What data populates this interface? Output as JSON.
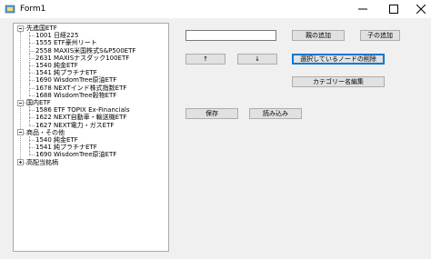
{
  "window": {
    "title": "Form1"
  },
  "tree": {
    "nodes": [
      {
        "label": "先進国ETF",
        "level": 0,
        "expander": "expanded"
      },
      {
        "label": "1001 日経225",
        "level": 1
      },
      {
        "label": "1555 ETF豪州リート",
        "level": 1
      },
      {
        "label": "2558 MAXIS米国株式S&P500ETF",
        "level": 1
      },
      {
        "label": "2631 MAXISナスダック100ETF",
        "level": 1
      },
      {
        "label": "1540 純金ETF",
        "level": 1
      },
      {
        "label": "1541 純プラチナETF",
        "level": 1
      },
      {
        "label": "1690 WisdomTree原油ETF",
        "level": 1
      },
      {
        "label": "1678 NEXTインド株式指数ETF",
        "level": 1
      },
      {
        "label": "1688 WisdomTree穀物ETF",
        "level": 1
      },
      {
        "label": "国内ETF",
        "level": 0,
        "expander": "expanded"
      },
      {
        "label": "1586 ETF TOPIX Ex-Financials",
        "level": 1
      },
      {
        "label": "1622 NEXT自動車・輸送機ETF",
        "level": 1
      },
      {
        "label": "1627 NEXT電力・ガスETF",
        "level": 1
      },
      {
        "label": "商品・その他",
        "level": 0,
        "expander": "expanded"
      },
      {
        "label": "1540 純金ETF",
        "level": 1
      },
      {
        "label": "1541 純プラチナETF",
        "level": 1
      },
      {
        "label": "1690 WisdomTree原油ETF",
        "level": 1
      },
      {
        "label": "高配当銘柄",
        "level": 0,
        "expander": "collapsed"
      }
    ]
  },
  "form": {
    "name_input_value": "",
    "add_parent_label": "親の追加",
    "add_child_label": "子の追加",
    "move_up_label": "↑",
    "move_down_label": "↓",
    "delete_node_label": "選択しているノードの削除",
    "edit_category_label": "カテゴリー名編集",
    "save_label": "保存",
    "load_label": "読み込み"
  }
}
